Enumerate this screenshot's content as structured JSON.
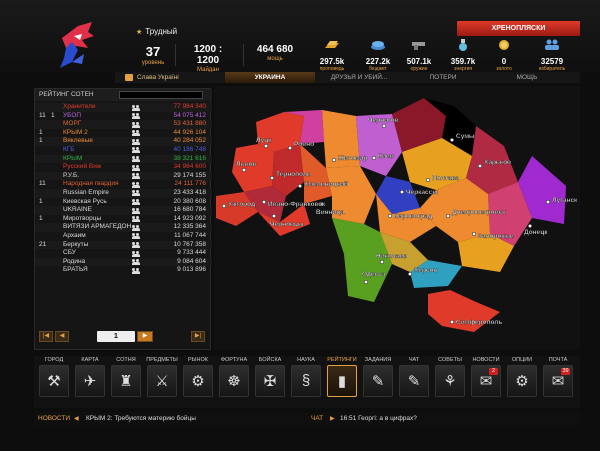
{
  "header": {
    "difficulty": "Трудный",
    "stats": [
      {
        "value": "37",
        "label": "уровень"
      },
      {
        "value": "1200 : 1200",
        "label": "Майдан"
      },
      {
        "value": "464 680",
        "label": "мощь"
      }
    ],
    "dancer_label": "ХРЕНОПЛЯСКИ",
    "resources": [
      {
        "value": "297.5k",
        "label": "проповедь",
        "icon": "gold-bar-icon"
      },
      {
        "value": "227.2k",
        "label": "бюджет",
        "icon": "money-stack-icon"
      },
      {
        "value": "507.1k",
        "label": "оружие",
        "icon": "gun-icon"
      },
      {
        "value": "359.7k",
        "label": "энергия",
        "icon": "potion-icon"
      },
      {
        "value": "0",
        "label": "золото",
        "icon": "gold-coin-icon"
      },
      {
        "value": "32579",
        "label": "избиратель",
        "icon": "people-icon"
      }
    ]
  },
  "tabs": [
    {
      "label": "Слава Україні"
    },
    {
      "label": "УКРАИНА"
    },
    {
      "label": "ДРУЗЬЯ И УБИЙ..."
    },
    {
      "label": "ПОТЕРИ"
    },
    {
      "label": "МОЩЬ"
    }
  ],
  "rating": {
    "title": "РЕЙТИНГ СОТЕН",
    "search_placeholder": "",
    "rows": [
      {
        "rank": "",
        "pos": "",
        "name": "Хранители",
        "score": "77 984 340",
        "color": "#e03a2a"
      },
      {
        "rank": "11",
        "pos": "1",
        "name": "УБОП",
        "score": "54 075 412",
        "color": "#c060e0"
      },
      {
        "rank": "",
        "pos": "",
        "name": "МОРГ",
        "score": "53 431 880",
        "color": "#e06030"
      },
      {
        "rank": "1",
        "pos": "",
        "name": "КРЫМ 2",
        "score": "44 926 104",
        "color": "#ee8a30"
      },
      {
        "rank": "1",
        "pos": "",
        "name": "Вяклевые",
        "score": "40 284 052",
        "color": "#ee8a30"
      },
      {
        "rank": "",
        "pos": "",
        "name": "КГБ",
        "score": "40 186 748",
        "color": "#5060e0"
      },
      {
        "rank": "",
        "pos": "",
        "name": "КРЫМ",
        "score": "38 321 616",
        "color": "#30b040"
      },
      {
        "rank": "",
        "pos": "",
        "name": "Русский Виж",
        "score": "34 984 600",
        "color": "#e03a2a"
      },
      {
        "rank": "",
        "pos": "",
        "name": "Р.У.Б.",
        "score": "29 174 155",
        "color": "#d8d8d8"
      },
      {
        "rank": "11",
        "pos": "",
        "name": "Народная гвардия",
        "score": "24 111 776",
        "color": "#e06030"
      },
      {
        "rank": "",
        "pos": "",
        "name": "Russian Empire",
        "score": "23 433 418",
        "color": "#d8d8d8"
      },
      {
        "rank": "1",
        "pos": "",
        "name": "Киевская Русь",
        "score": "20 380 608",
        "color": "#d8d8d8"
      },
      {
        "rank": "",
        "pos": "",
        "name": "UKRAINE",
        "score": "16 680 784",
        "color": "#d8d8d8"
      },
      {
        "rank": "1",
        "pos": "",
        "name": "Миротворцы",
        "score": "14 923 092",
        "color": "#d8d8d8"
      },
      {
        "rank": "",
        "pos": "",
        "name": "ВИТЯЗИ АРМАГЕДОН",
        "score": "12 335 364",
        "color": "#d8d8d8"
      },
      {
        "rank": "",
        "pos": "",
        "name": "Архаим",
        "score": "11 067 744",
        "color": "#d8d8d8"
      },
      {
        "rank": "21",
        "pos": "",
        "name": "Беркуты",
        "score": "10 767 358",
        "color": "#d8d8d8"
      },
      {
        "rank": "",
        "pos": "",
        "name": "СБУ",
        "score": "9 733 444",
        "color": "#d8d8d8"
      },
      {
        "rank": "",
        "pos": "",
        "name": "Родина",
        "score": "9 084 604",
        "color": "#d8d8d8"
      },
      {
        "rank": "",
        "pos": "",
        "name": "БРАТЬЯ",
        "score": "9 013 896",
        "color": "#d8d8d8"
      }
    ],
    "page": "1"
  },
  "map": {
    "cities": [
      "Чернигов",
      "Сумы",
      "Луцк",
      "Ровно",
      "Житомир",
      "Киев",
      "Харьков",
      "Львов",
      "Тернополь",
      "Хмельницкий",
      "Винница",
      "Черкассы",
      "Полтава",
      "Луганск",
      "Ужгород",
      "Ивано-Франковск",
      "Черновцы",
      "Кировоград",
      "Днепропетровск",
      "Донецк",
      "Запорожье",
      "Николаев",
      "Херсон",
      "Одесса",
      "Симферополь"
    ]
  },
  "nav": [
    {
      "label": "ГОРОД",
      "icon": "shovel-icon",
      "glyph": "⚒"
    },
    {
      "label": "КАРТА",
      "icon": "map-icon",
      "glyph": "✈"
    },
    {
      "label": "СОТНЯ",
      "icon": "helmet-icon",
      "glyph": "♜"
    },
    {
      "label": "ПРЕДМЕТЫ",
      "icon": "items-icon",
      "glyph": "⚔"
    },
    {
      "label": "РЫНОК",
      "icon": "coins-icon",
      "glyph": "⚙"
    },
    {
      "label": "ФОРТУНА",
      "icon": "wheel-icon",
      "glyph": "☸"
    },
    {
      "label": "БОЙСКА",
      "icon": "tank-icon",
      "glyph": "✠"
    },
    {
      "label": "НАУКА",
      "icon": "dna-icon",
      "glyph": "§"
    },
    {
      "label": "РЕЙТИНГИ",
      "icon": "ratings-icon",
      "glyph": "▮"
    },
    {
      "label": "ЗАДАНИЯ",
      "icon": "tasks-icon",
      "glyph": "✎"
    },
    {
      "label": "ЧАТ",
      "icon": "chat-icon",
      "glyph": "✎"
    },
    {
      "label": "СОВЕТЫ",
      "icon": "advice-icon",
      "glyph": "⚘"
    },
    {
      "label": "НОВОСТИ",
      "icon": "news-icon",
      "glyph": "✉",
      "badge": "2"
    },
    {
      "label": "ОПЦИИ",
      "icon": "gear-icon",
      "glyph": "⚙"
    },
    {
      "label": "ПОЧТА",
      "icon": "mail-icon",
      "glyph": "✉",
      "badge": "39"
    }
  ],
  "ticker": {
    "news_label": "НОВОСТИ",
    "news_text": "КРЫМ 2: Требуются материю бойцы",
    "chat_label": "ЧАТ",
    "chat_text": "16:51 Георгі: а в цифрах?"
  }
}
